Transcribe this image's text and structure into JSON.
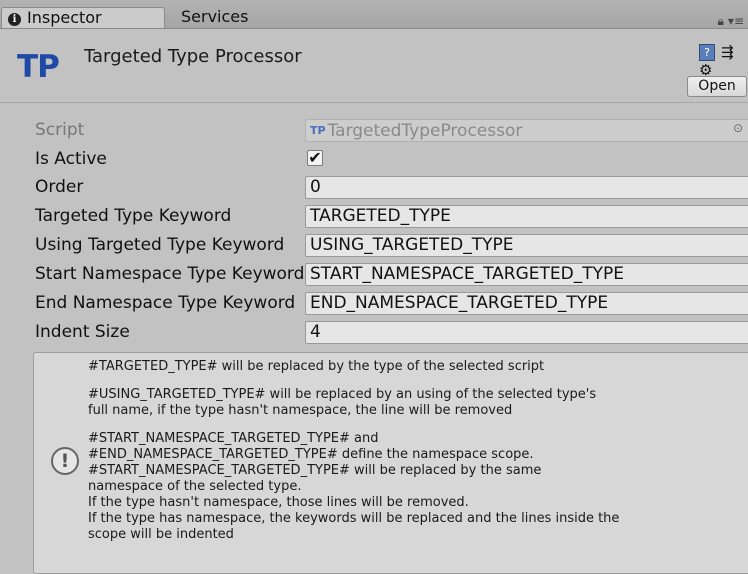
{
  "tabs": {
    "inspector": "Inspector",
    "services": "Services"
  },
  "header": {
    "logo_text": "TP",
    "title": "Targeted Type Processor",
    "open_label": "Open",
    "logo_color": "#1e4aa6"
  },
  "fields": {
    "script_label": "Script",
    "script_icon": "TP",
    "script_value": "TargetedTypeProcessor",
    "is_active_label": "Is Active",
    "is_active_checked": "✔",
    "order_label": "Order",
    "order_value": "0",
    "targeted_label": "Targeted Type Keyword",
    "targeted_value": "TARGETED_TYPE",
    "using_label": "Using Targeted Type Keyword",
    "using_value": "USING_TARGETED_TYPE",
    "start_label": "Start Namespace Type Keyword",
    "start_value": "START_NAMESPACE_TARGETED_TYPE",
    "end_label": "End Namespace Type Keyword",
    "end_value": "END_NAMESPACE_TARGETED_TYPE",
    "indent_label": "Indent Size",
    "indent_value": "4"
  },
  "help": {
    "icon_symbol": "!",
    "p1": "#TARGETED_TYPE# will be replaced by the type of the selected script",
    "p2": "#USING_TARGETED_TYPE# will be replaced by an using of the selected type's\nfull name, if the type hasn't namespace, the line will be removed",
    "p3": "#START_NAMESPACE_TARGETED_TYPE# and\n#END_NAMESPACE_TARGETED_TYPE# define the namespace scope.\n#START_NAMESPACE_TARGETED_TYPE# will be replaced by the same\nnamespace of the selected type.\nIf the type hasn't namespace, those lines will be removed.\nIf the type has namespace, the keywords will be replaced and the lines inside the\nscope will be indented"
  }
}
